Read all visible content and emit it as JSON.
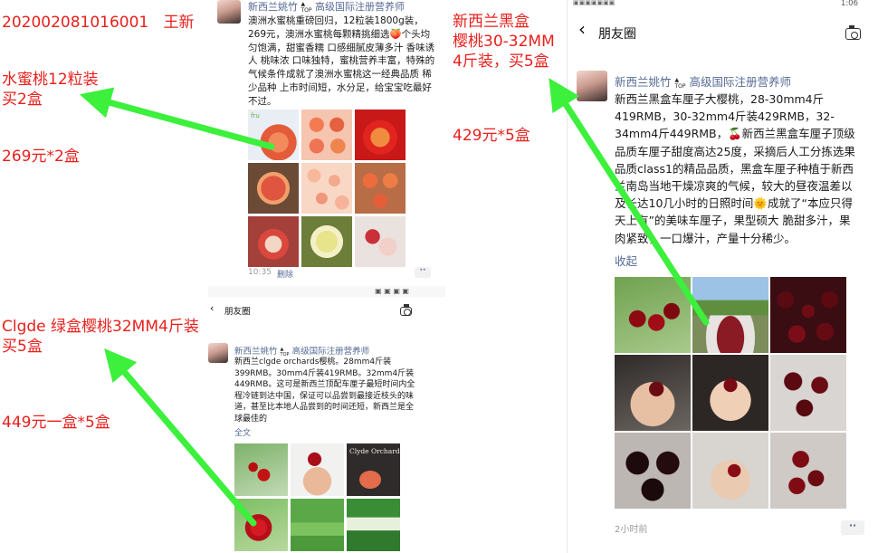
{
  "annotations": {
    "order_id": "202002081016001   王新",
    "item1": "水蜜桃12粒装\n买2盒",
    "price1": "269元*2盒",
    "item2": "Clgde 绿盒樱桃32MM4斤装\n买5盒",
    "price2": "449元一盒*5盒",
    "item3": "新西兰黑盒\n樱桃30-32MM\n4斤装，买5盒",
    "price3": "429元*5盒"
  },
  "colors": {
    "annotation_red": "#e8201c",
    "arrow_green": "#3cf03c",
    "author_blue": "#576b95"
  },
  "peach_post": {
    "author": "新西兰姚竹",
    "author_title": "高级国际注册营养师",
    "badge": "TOP",
    "text": "澳洲水蜜桃重磅回归，12粒装1800g装，269元，澳洲水蜜桃每颗精挑细选🍑个头均匀饱满，甜蜜香糯 口感细腻皮薄多汁 香味诱人 桃味浓 口味独特，蜜桃营养丰富，特殊的气候条件成就了澳洲水蜜桃这一经典品质 稀少品种 上市时间短，水分足，给宝宝吃最好不过。",
    "time": "10:35",
    "delete_label": "删除",
    "images": [
      "peach-box-image",
      "peach-tray-image",
      "peach-red-box-image",
      "peach-whole-image",
      "peach-pile-image",
      "peach-crate-image",
      "peach-half-image",
      "peach-yellow-image",
      "peach-slices-image"
    ]
  },
  "clgde_post": {
    "header_title": "朋友圈",
    "author": "新西兰姚竹",
    "author_title": "高级国际注册营养师",
    "badge": "TOP",
    "text": "新西兰clgde orchards樱桃。28mm4斤装399RMB。30mm4斤装419RMB。32mm4斤装449RMB。这可是新西兰顶配车厘子最短时间内全程冷链到达中国，保证可以品尝到最接近枝头的味道，甚至比本地人品尝到的时间还短，新西兰是全球最佳的",
    "expand_label": "全文",
    "images": [
      "cherry-branch-image",
      "cherry-hand-image",
      "clgde-orchards-box-image",
      "cherry-bag-image",
      "clgde-green-boxes-image",
      "cherry-pack-image"
    ],
    "box_brand": "Clyde Orchard"
  },
  "black_box_post": {
    "status_time": "1:06",
    "header_title": "朋友圈",
    "author": "新西兰姚竹",
    "author_title": "高级国际注册营养师",
    "badge": "TOP",
    "text": "新西兰黑盒车厘子大樱桃，28-30mm4斤419RMB，30-32mm4斤装429RMB，32-34mm4斤449RMB，🍒新西兰黑盒车厘子顶级品质车厘子甜度高达25度，采摘后人工分拣选果 品质class1的精品品质，黑盒车厘子种植于新西兰南岛当地干燥凉爽的气候，较大的昼夜温差以及长达10几小时的日照时间🌞成就了“本应只得天上有”的美味车厘子，果型硕大 脆甜多汁，果肉紧致，一口爆汁，产量十分稀少。",
    "collapse_label": "收起",
    "time": "2小时前",
    "images": [
      "cherry-cluster-image",
      "cherry-orchard-box-image",
      "cherry-pile-image",
      "cherry-palm-image",
      "cherry-single-hand-image",
      "cherry-trays-image",
      "cherry-boxes-image",
      "cherry-hold-image",
      "cherry-tray-top-image"
    ]
  }
}
